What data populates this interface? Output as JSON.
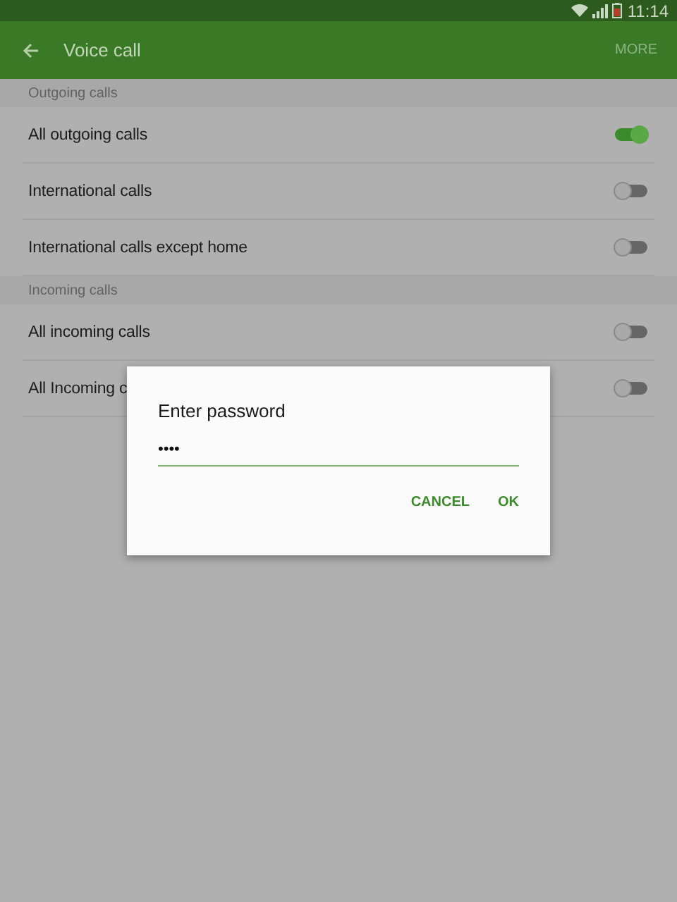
{
  "status_bar": {
    "time": "11:14"
  },
  "app_bar": {
    "title": "Voice call",
    "action": "MORE"
  },
  "sections": [
    {
      "header": "Outgoing calls",
      "items": [
        {
          "label": "All outgoing calls",
          "on": true
        },
        {
          "label": "International calls",
          "on": false
        },
        {
          "label": "International calls except home",
          "on": false
        }
      ]
    },
    {
      "header": "Incoming calls",
      "items": [
        {
          "label": "All incoming calls",
          "on": false
        },
        {
          "label": "All Incoming c",
          "on": false
        }
      ]
    }
  ],
  "dialog": {
    "title": "Enter password",
    "value": "••••",
    "buttons": [
      "CANCEL",
      "OK"
    ]
  }
}
